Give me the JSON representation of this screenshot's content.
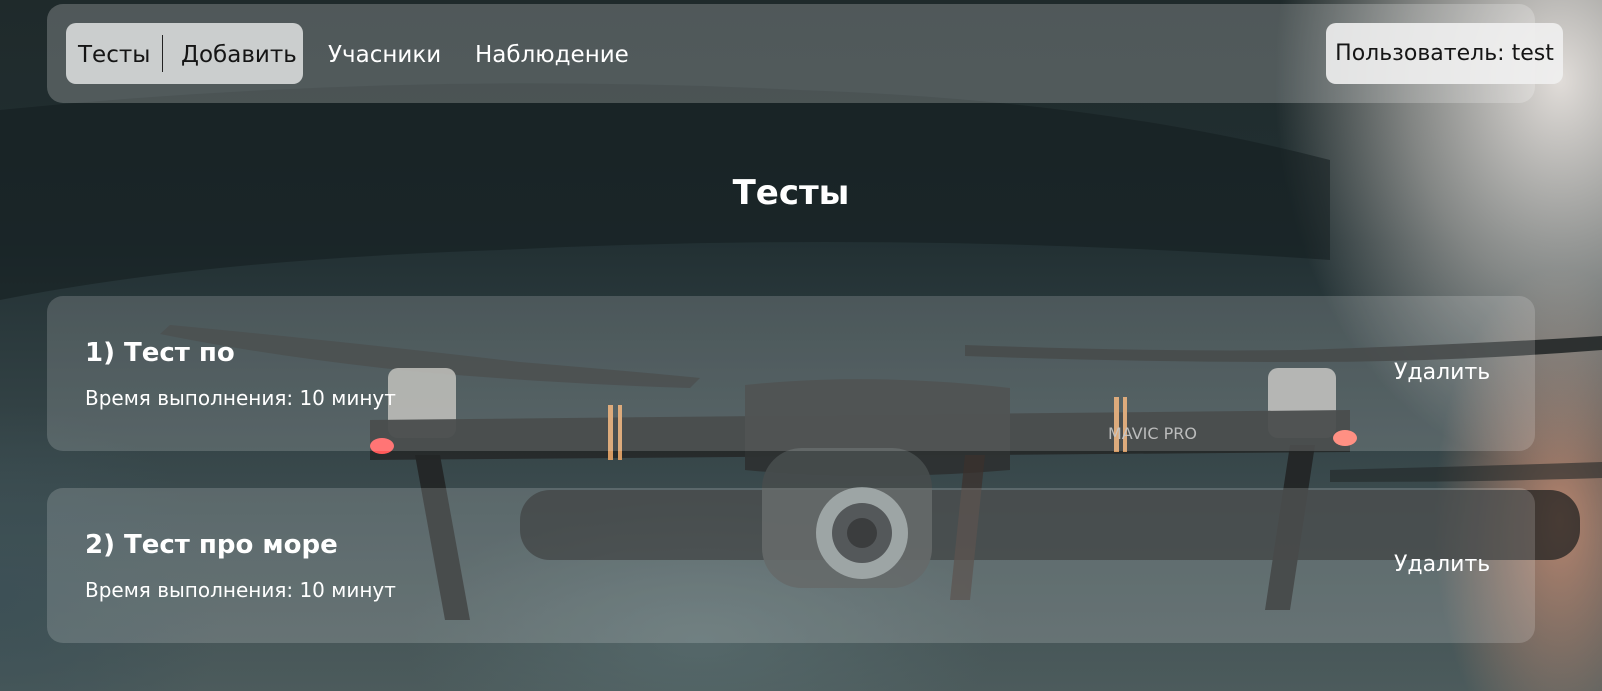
{
  "nav": {
    "tests_label": "Тесты",
    "add_label": "Добавить",
    "participants_label": "Учасники",
    "observation_label": "Наблюдение",
    "user_label": "Пользователь: test"
  },
  "page_title": "Тесты",
  "tests": [
    {
      "title": "1) Тест по",
      "duration": "Время выполнения: 10 минут",
      "delete_label": "Удалить"
    },
    {
      "title": "2) Тест про море",
      "duration": "Время выполнения: 10 минут",
      "delete_label": "Удалить"
    }
  ],
  "background": {
    "drone_logo": "MAVIC PRO"
  }
}
